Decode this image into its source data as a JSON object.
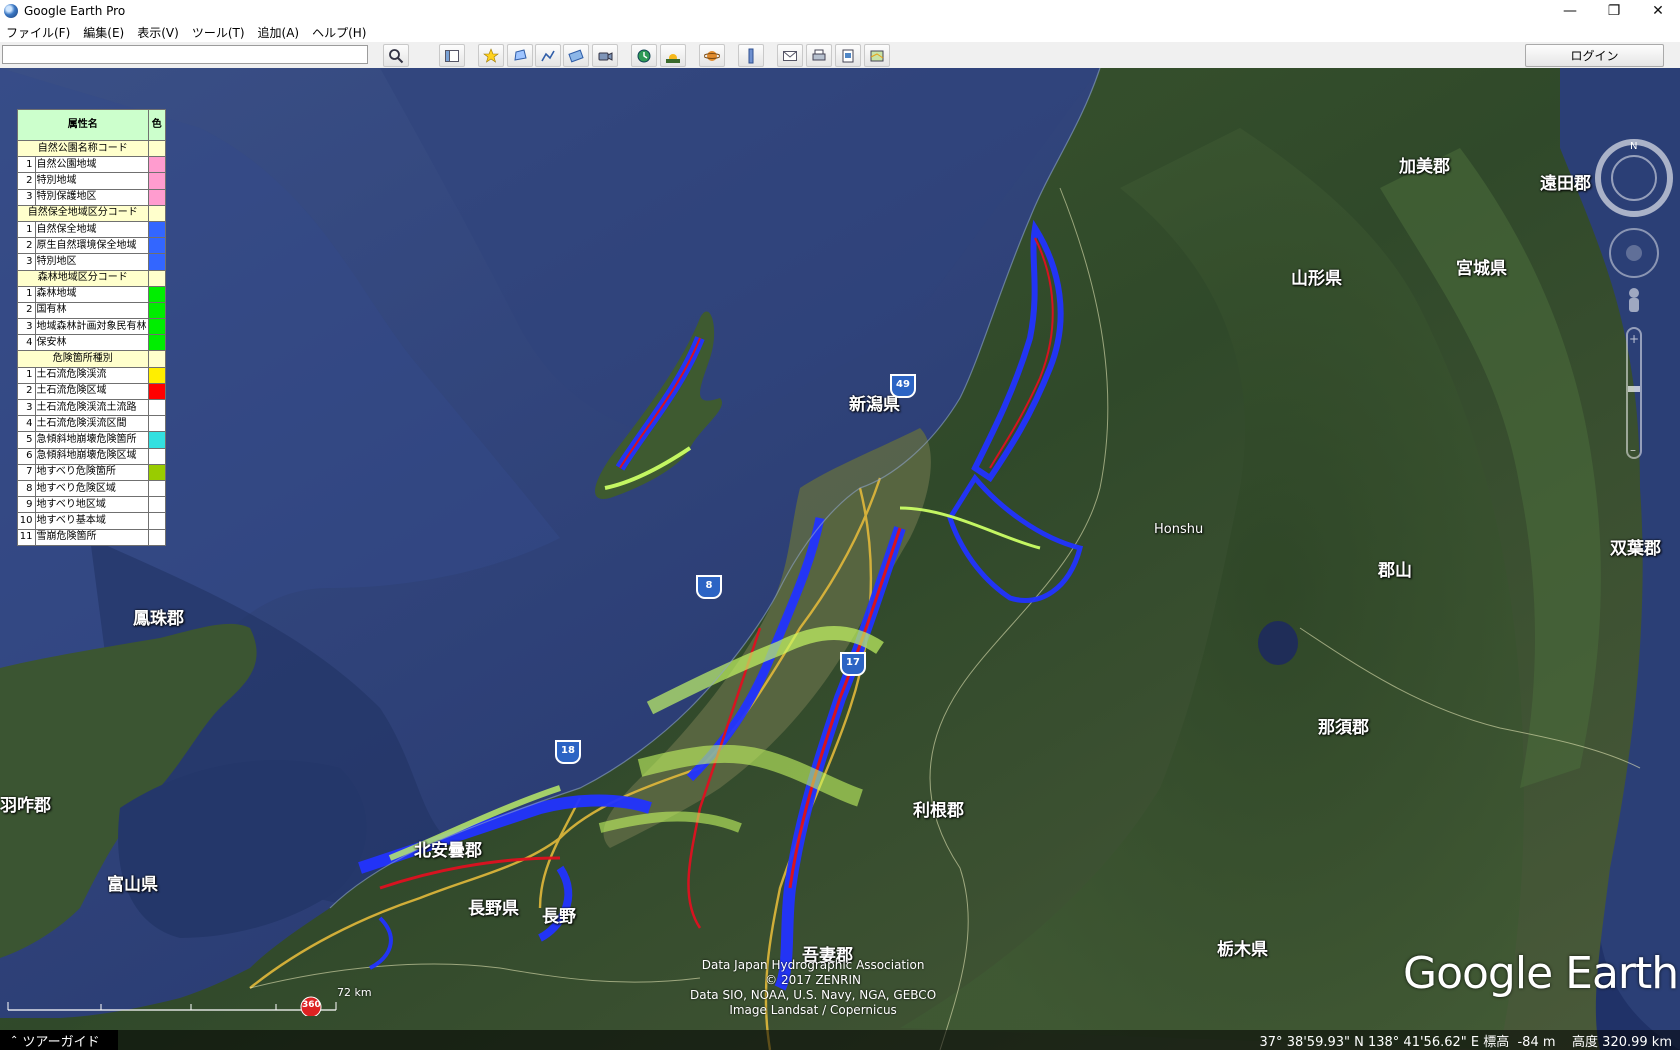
{
  "window": {
    "title": "Google Earth Pro",
    "controls": {
      "minimize": "—",
      "restore": "❐",
      "close": "✕"
    }
  },
  "menu": [
    "ファイル(F)",
    "編集(E)",
    "表示(V)",
    "ツール(T)",
    "追加(A)",
    "ヘルプ(H)"
  ],
  "toolbar": {
    "search_value": "",
    "login_label": "ログイン"
  },
  "legend": {
    "header": {
      "name": "属性名",
      "color": "色"
    },
    "sections": [
      {
        "title": "自然公園名称コード",
        "items": [
          {
            "no": "1",
            "label": "自然公園地域",
            "color": "#ff9ccf"
          },
          {
            "no": "2",
            "label": "特別地域",
            "color": "#ff9ccf"
          },
          {
            "no": "3",
            "label": "特別保護地区",
            "color": "#ff9ccf"
          }
        ]
      },
      {
        "title": "自然保全地域区分コード",
        "items": [
          {
            "no": "1",
            "label": "自然保全地域",
            "color": "#3366ff"
          },
          {
            "no": "2",
            "label": "原生自然環境保全地域",
            "color": "#3366ff"
          },
          {
            "no": "3",
            "label": "特別地区",
            "color": "#3366ff"
          }
        ]
      },
      {
        "title": "森林地域区分コード",
        "items": [
          {
            "no": "1",
            "label": "森林地域",
            "color": "#00ee00"
          },
          {
            "no": "2",
            "label": "国有林",
            "color": "#00ee00"
          },
          {
            "no": "3",
            "label": "地域森林計画対象民有林",
            "color": "#00ee00"
          },
          {
            "no": "4",
            "label": "保安林",
            "color": "#00ee00"
          }
        ]
      },
      {
        "title": "危険箇所種別",
        "items": [
          {
            "no": "1",
            "label": "土石流危険渓流",
            "color": "#ffee00"
          },
          {
            "no": "2",
            "label": "土石流危険区域",
            "color": "#ff0000"
          },
          {
            "no": "3",
            "label": "土石流危険渓流土流路",
            "color": "#ffffff"
          },
          {
            "no": "4",
            "label": "土石流危険渓流区間",
            "color": "#ffffff"
          },
          {
            "no": "5",
            "label": "急傾斜地崩壊危険箇所",
            "color": "#33e0e0"
          },
          {
            "no": "6",
            "label": "急傾斜地崩壊危険区域",
            "color": "#ffffff"
          },
          {
            "no": "7",
            "label": "地すべり危険箇所",
            "color": "#99cc00"
          },
          {
            "no": "8",
            "label": "地すべり危険区域",
            "color": "#ffffff"
          },
          {
            "no": "9",
            "label": "地すべり地区域",
            "color": "#ffffff"
          },
          {
            "no": "10",
            "label": "地すべり基本域",
            "color": "#ffffff"
          },
          {
            "no": "11",
            "label": "雪崩危険箇所",
            "color": "#ffffff"
          }
        ]
      }
    ]
  },
  "places": {
    "kami": "加美郡",
    "toda": "遠田郡",
    "yamagata": "山形県",
    "miyagi": "宮城県",
    "niigata": "新潟県",
    "honshu": "Honshu",
    "futaba": "双葉郡",
    "koriyama": "郡山",
    "hosu": "鳳珠郡",
    "nasu": "那須郡",
    "hakui": "羽咋郡",
    "tone": "利根郡",
    "kitaazumi": "北安曇郡",
    "toyama": "富山県",
    "naganoken": "長野県",
    "nagano": "長野",
    "tochigi": "栃木県",
    "agatsuma": "吾妻郡"
  },
  "highways": {
    "h49": "49",
    "h8": "8",
    "h17": "17",
    "h18": "18"
  },
  "attribution": [
    "Data Japan Hydrographic Association",
    "© 2017 ZENRIN",
    "Data SIO, NOAA, U.S. Navy, NGA, GEBCO",
    "Image Landsat / Copernicus"
  ],
  "logo": "Google Earth",
  "scale": {
    "label": "72 km",
    "badge": "360"
  },
  "status": {
    "tour": "ツアーガイド",
    "coordinates": "37° 38'59.93\" N 138° 41'56.62\" E 標高  -84 m    高度 320.99 km"
  },
  "colors": {
    "sea": "#25386e",
    "land": "#34512a",
    "toolbar": "#f0f0f0"
  }
}
